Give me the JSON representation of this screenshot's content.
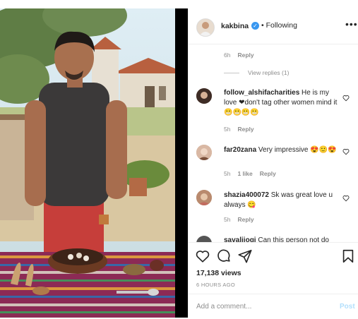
{
  "header": {
    "username": "kakbina",
    "verified_mark": "✓",
    "follow_label": "• Following",
    "more_label": "•••"
  },
  "comments": [
    {
      "meta_time": "6h",
      "meta_reply": "Reply"
    },
    {
      "view_replies": "View replies (1)"
    },
    {
      "user": "follow_alshifacharities",
      "text": "He is my love ❤don't tag other women mind it 😬😬😬😬",
      "time": "5h",
      "reply": "Reply"
    },
    {
      "user": "far20zana",
      "text": "Very impressive 😍🙂😍",
      "time": "5h",
      "likes": "1 like",
      "reply": "Reply"
    },
    {
      "user": "shazia400072",
      "text": "Sk was great love u always 😋",
      "time": "5h",
      "reply": "Reply"
    },
    {
      "user": "savalijogi",
      "text": "Can this person not do"
    }
  ],
  "actions": {
    "views": "17,138 views",
    "time_ago": "6 HOURS AGO",
    "comment_placeholder": "Add a comment...",
    "post_label": "Post"
  },
  "colors": {
    "accent": "#3897f0",
    "muted": "#8e8e8e",
    "post_disabled": "#b2dffc"
  },
  "icons": [
    "heart-icon",
    "comment-icon",
    "share-icon",
    "bookmark-icon",
    "more-icon",
    "verified-icon"
  ]
}
